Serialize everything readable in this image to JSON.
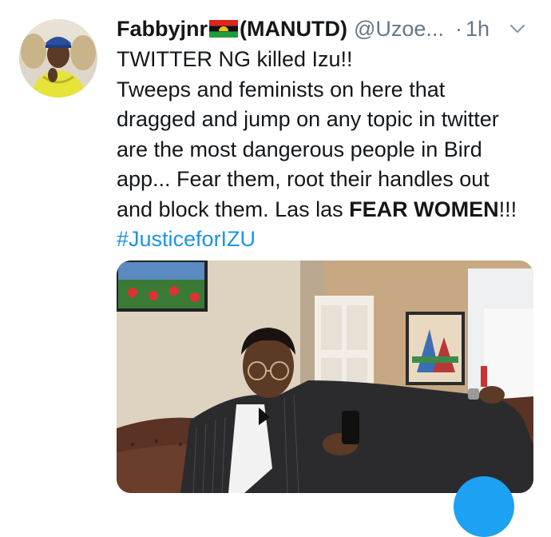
{
  "tweet": {
    "display_name": "Fabbyjnr",
    "display_name_suffix": "(MANUTD)",
    "handle": "@Uzoe...",
    "separator": "·",
    "time": "1h",
    "text_lines": [
      "TWITTER NG killed Izu!!",
      "Tweeps and feminists on here that",
      "dragged and jump on any topic in twitter",
      "are the most dangerous people in Bird",
      "app... Fear them, root their handles out"
    ],
    "last_line_prefix": "and block them. Las las ",
    "last_line_bold": "FEAR WOMEN",
    "last_line_suffix": "!!!",
    "hashtag": "#JusticeforIZU"
  },
  "icons": {
    "avatar": "user-avatar-photo",
    "flag": "biafra-flag-icon",
    "caret": "chevron-down-icon",
    "compose": "compose-fab-icon"
  },
  "colors": {
    "text": "#14171a",
    "muted": "#657786",
    "link": "#1b95e0",
    "fab": "#1da1f2"
  }
}
